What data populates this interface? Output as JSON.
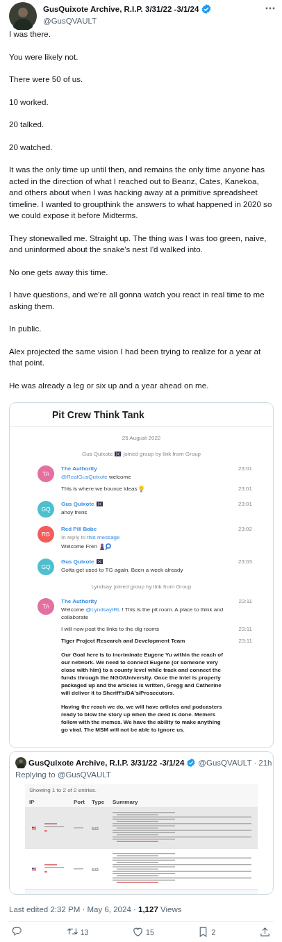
{
  "tweet": {
    "author": {
      "name": "GusQuixote Archive, R.I.P. 3/31/22 -3/1/24",
      "verified": true,
      "handle": "@GusQVAULT"
    },
    "paragraphs": [
      "I was there.",
      "You were likely not.",
      "There were 50 of us.",
      "10 worked.",
      "20 talked.",
      "20 watched.",
      "It was the only time up until then, and remains the only time anyone has acted in the direction of what I reached out to Beanz, Cates, Kanekoa, and others about when I was hacking away at a primitive spreadsheet timeline. I wanted to groupthink the answers to what happened in 2020 so we could expose it before Midterms.",
      "They stonewalled me. Straight up. The thing was I was too green, naive, and uninformed about the snake's nest I'd walked into.",
      "No one gets away this time.",
      "I have questions, and we're all gonna watch you react in real time to me asking them.",
      "In public.",
      "Alex projected the same vision I had been trying to realize for a year at that point.",
      "He was already a leg or six up and a year ahead on me."
    ],
    "chat_screenshot": {
      "title": "Pit Crew Think Tank",
      "items": [
        {
          "kind": "date",
          "text": "25 August 2022"
        },
        {
          "kind": "service",
          "actor": "Gus Quixote",
          "actor_badge": true,
          "text": "joined group by link from Group"
        },
        {
          "kind": "message",
          "initials": "TA",
          "color": "#e4709f",
          "name": "The Authority",
          "name_badge": false,
          "time": "23:01",
          "body": [
            [
              {
                "kind": "mention",
                "text": "@RealGusQuixote"
              },
              {
                "kind": "plain",
                "text": " welcome"
              }
            ]
          ],
          "followups": [
            {
              "parts": [
                {
                  "kind": "plain",
                  "text": "This is where we bounce ideas"
                }
              ],
              "decor": {
                "kind": "bulb"
              },
              "time": "23:01"
            }
          ]
        },
        {
          "kind": "message",
          "initials": "GQ",
          "color": "#4fbfcf",
          "name": "Gus Quixote",
          "name_badge": true,
          "time": "23:01",
          "body": [
            [
              {
                "kind": "plain",
                "text": "ahoy frens"
              }
            ]
          ]
        },
        {
          "kind": "message",
          "initials": "RB",
          "color": "#f45b5b",
          "name": "Red Pill Babe",
          "name_badge": false,
          "time": "23:02",
          "reply": {
            "prefix": "In reply to",
            "link": "this message"
          },
          "body": [
            [
              {
                "kind": "plain",
                "text": "Welcome Fren"
              }
            ]
          ],
          "body_decor": {
            "kind": "figure-magnifier"
          }
        },
        {
          "kind": "message",
          "initials": "GQ",
          "color": "#4fbfcf",
          "name": "Gus Quixote",
          "name_badge": true,
          "time": "23:03",
          "body": [
            [
              {
                "kind": "plain",
                "text": "Gotta get used to TG again. Been a week already"
              }
            ]
          ]
        },
        {
          "kind": "service",
          "actor": "Lyndsay",
          "actor_badge": false,
          "text": "joined group by link from Group"
        },
        {
          "kind": "message",
          "initials": "TA",
          "color": "#e4709f",
          "name": "The Authority",
          "name_badge": false,
          "time": "23:11",
          "body": [
            [
              {
                "kind": "plain",
                "text": "Welcome "
              },
              {
                "kind": "mention",
                "text": "@LyndsayIRL"
              },
              {
                "kind": "plain",
                "text": " ! This is the pit room. A place to think and collaborate"
              }
            ]
          ],
          "followups": [
            {
              "parts": [
                {
                  "kind": "plain",
                  "text": "I will now post the links to the dig rooms"
                }
              ],
              "time": "23:11"
            },
            {
              "parts": [
                {
                  "kind": "bold",
                  "text": "Tiger Project Research and Development Team"
                }
              ],
              "time": "23:11"
            },
            {
              "parts": [
                {
                  "kind": "bold",
                  "text": "Our Goal here is to incriminate Eugene Yu within the reach of our network. We need to connect Eugene (or someone very close with him) to a county level while track and connect the funds through the NGO/University. Once the intel is properly packaged up and the articles is written, Gregg and Catherine will deliver it to Sheriff's/DA's/Prosecutors."
                }
              ]
            },
            {
              "parts": [
                {
                  "kind": "bold",
                  "text": "Having the reach we do, we will have articles and podcasters ready to blow the story up when the deed is done. Memers follow with the memes. We have the ability to make anything go viral. The MSM will not be able to ignore us."
                }
              ]
            }
          ]
        }
      ]
    },
    "quote": {
      "author": {
        "name": "GusQuixote Archive, R.I.P. 3/31/22 -3/1/24",
        "verified": true,
        "handle": "@GusQVAULT"
      },
      "separator": "·",
      "age": "21h",
      "replying_to": "Replying to @GusQVAULT",
      "table_screenshot": {
        "caption": "Showing 1 to 2 of 2 entries.",
        "columns": [
          "IP",
          "Port",
          "Type",
          "Summary"
        ],
        "rows": [
          {
            "type": "ssl"
          },
          {
            "type": "ssl"
          }
        ]
      }
    },
    "meta": "Last edited 2:32 PM · May 6, 2024 · **1,127** Views",
    "actions": [
      {
        "kind": "reply"
      },
      {
        "kind": "retweet",
        "count": "13"
      },
      {
        "kind": "like",
        "count": "15"
      },
      {
        "kind": "bookmark",
        "count": "2"
      },
      {
        "kind": "share"
      }
    ]
  }
}
